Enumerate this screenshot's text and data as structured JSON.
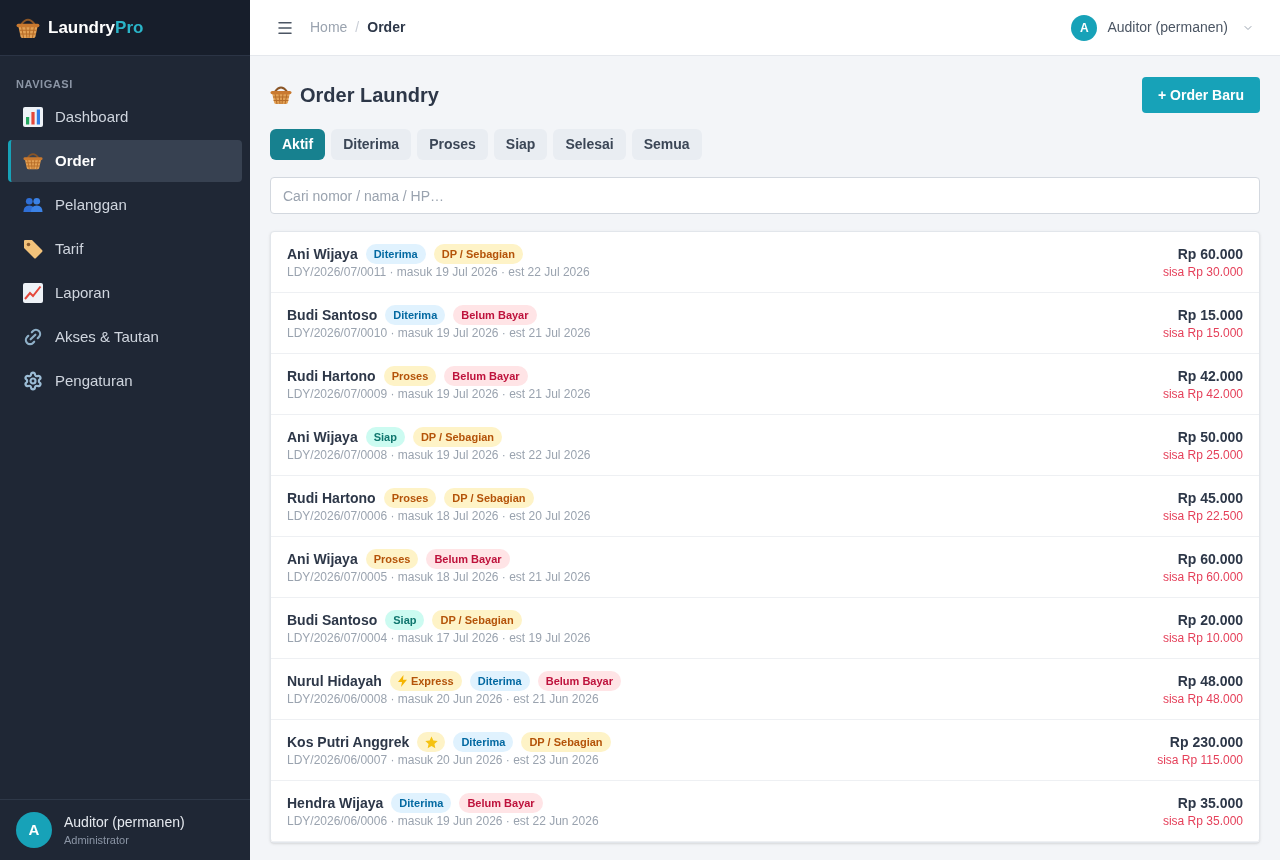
{
  "sidebar": {
    "brand": {
      "name": "Laundry",
      "accent": "Pro"
    },
    "section_label": "NAVIGASI",
    "items": [
      {
        "label": "Dashboard",
        "selected": false
      },
      {
        "label": "Order",
        "selected": true
      },
      {
        "label": "Pelanggan",
        "selected": false
      },
      {
        "label": "Tarif",
        "selected": false
      },
      {
        "label": "Laporan",
        "selected": false
      },
      {
        "label": "Akses & Tautan",
        "selected": false
      },
      {
        "label": "Pengaturan",
        "selected": false
      }
    ],
    "user": {
      "initial": "A",
      "name": "Auditor (permanen)",
      "role": "Administrator"
    }
  },
  "topbar": {
    "breadcrumb": {
      "parent": "Home",
      "separator": "/",
      "current": "Order"
    },
    "user": {
      "initial": "A",
      "name": "Auditor (permanen)"
    }
  },
  "page": {
    "title": "Order Laundry",
    "new_button": "+ Order Baru"
  },
  "tabs": [
    {
      "label": "Aktif",
      "selected": true
    },
    {
      "label": "Diterima",
      "selected": false
    },
    {
      "label": "Proses",
      "selected": false
    },
    {
      "label": "Siap",
      "selected": false
    },
    {
      "label": "Selesai",
      "selected": false
    },
    {
      "label": "Semua",
      "selected": false
    }
  ],
  "search": {
    "placeholder": "Cari nomor / nama / HP…"
  },
  "orders": [
    {
      "customer": "Ani Wijaya",
      "badges": [
        {
          "kind": "label",
          "label": "Diterima",
          "color": "#0369a1"
        },
        {
          "kind": "label",
          "label": "DP / Sebagian",
          "color": "#b45309"
        }
      ],
      "meta": "LDY/2026/07/0011 · masuk 19 Jul 2026 · est 22 Jul 2026",
      "total": "Rp 60.000",
      "remaining": "sisa Rp 30.000"
    },
    {
      "customer": "Budi Santoso",
      "badges": [
        {
          "kind": "label",
          "label": "Diterima",
          "color": "#0369a1"
        },
        {
          "kind": "label",
          "label": "Belum Bayar",
          "color": "#be123c"
        }
      ],
      "meta": "LDY/2026/07/0010 · masuk 19 Jul 2026 · est 21 Jul 2026",
      "total": "Rp 15.000",
      "remaining": "sisa Rp 15.000"
    },
    {
      "customer": "Rudi Hartono",
      "badges": [
        {
          "kind": "label",
          "label": "Proses",
          "color": "#b45309"
        },
        {
          "kind": "label",
          "label": "Belum Bayar",
          "color": "#be123c"
        }
      ],
      "meta": "LDY/2026/07/0009 · masuk 19 Jul 2026 · est 21 Jul 2026",
      "total": "Rp 42.000",
      "remaining": "sisa Rp 42.000"
    },
    {
      "customer": "Ani Wijaya",
      "badges": [
        {
          "kind": "label",
          "label": "Siap",
          "color": "#0f766e"
        },
        {
          "kind": "label",
          "label": "DP / Sebagian",
          "color": "#b45309"
        }
      ],
      "meta": "LDY/2026/07/0008 · masuk 19 Jul 2026 · est 22 Jul 2026",
      "total": "Rp 50.000",
      "remaining": "sisa Rp 25.000"
    },
    {
      "customer": "Rudi Hartono",
      "badges": [
        {
          "kind": "label",
          "label": "Proses",
          "color": "#b45309"
        },
        {
          "kind": "label",
          "label": "DP / Sebagian",
          "color": "#b45309"
        }
      ],
      "meta": "LDY/2026/07/0006 · masuk 18 Jul 2026 · est 20 Jul 2026",
      "total": "Rp 45.000",
      "remaining": "sisa Rp 22.500"
    },
    {
      "customer": "Ani Wijaya",
      "badges": [
        {
          "kind": "label",
          "label": "Proses",
          "color": "#b45309"
        },
        {
          "kind": "label",
          "label": "Belum Bayar",
          "color": "#be123c"
        }
      ],
      "meta": "LDY/2026/07/0005 · masuk 18 Jul 2026 · est 21 Jul 2026",
      "total": "Rp 60.000",
      "remaining": "sisa Rp 60.000"
    },
    {
      "customer": "Budi Santoso",
      "badges": [
        {
          "kind": "label",
          "label": "Siap",
          "color": "#0f766e"
        },
        {
          "kind": "label",
          "label": "DP / Sebagian",
          "color": "#b45309"
        }
      ],
      "meta": "LDY/2026/07/0004 · masuk 17 Jul 2026 · est 19 Jul 2026",
      "total": "Rp 20.000",
      "remaining": "sisa Rp 10.000"
    },
    {
      "customer": "Nurul Hidayah",
      "badges": [
        {
          "kind": "express",
          "label": "Express",
          "color": "#b45309"
        },
        {
          "kind": "label",
          "label": "Diterima",
          "color": "#0369a1"
        },
        {
          "kind": "label",
          "label": "Belum Bayar",
          "color": "#be123c"
        }
      ],
      "meta": "LDY/2026/06/0008 · masuk 20 Jun 2026 · est 21 Jun 2026",
      "total": "Rp 48.000",
      "remaining": "sisa Rp 48.000"
    },
    {
      "customer": "Kos Putri Anggrek",
      "badges": [
        {
          "kind": "star",
          "color": "#fef3c7"
        },
        {
          "kind": "label",
          "label": "Diterima",
          "color": "#0369a1"
        },
        {
          "kind": "label",
          "label": "DP / Sebagian",
          "color": "#b45309"
        }
      ],
      "meta": "LDY/2026/06/0007 · masuk 20 Jun 2026 · est 23 Jun 2026",
      "total": "Rp 230.000",
      "remaining": "sisa Rp 115.000"
    },
    {
      "customer": "Hendra Wijaya",
      "badges": [
        {
          "kind": "label",
          "label": "Diterima",
          "color": "#0369a1"
        },
        {
          "kind": "label",
          "label": "Belum Bayar",
          "color": "#be123c"
        }
      ],
      "meta": "LDY/2026/06/0006 · masuk 19 Jun 2026 · est 22 Jun 2026",
      "total": "Rp 35.000",
      "remaining": "sisa Rp 35.000"
    }
  ]
}
